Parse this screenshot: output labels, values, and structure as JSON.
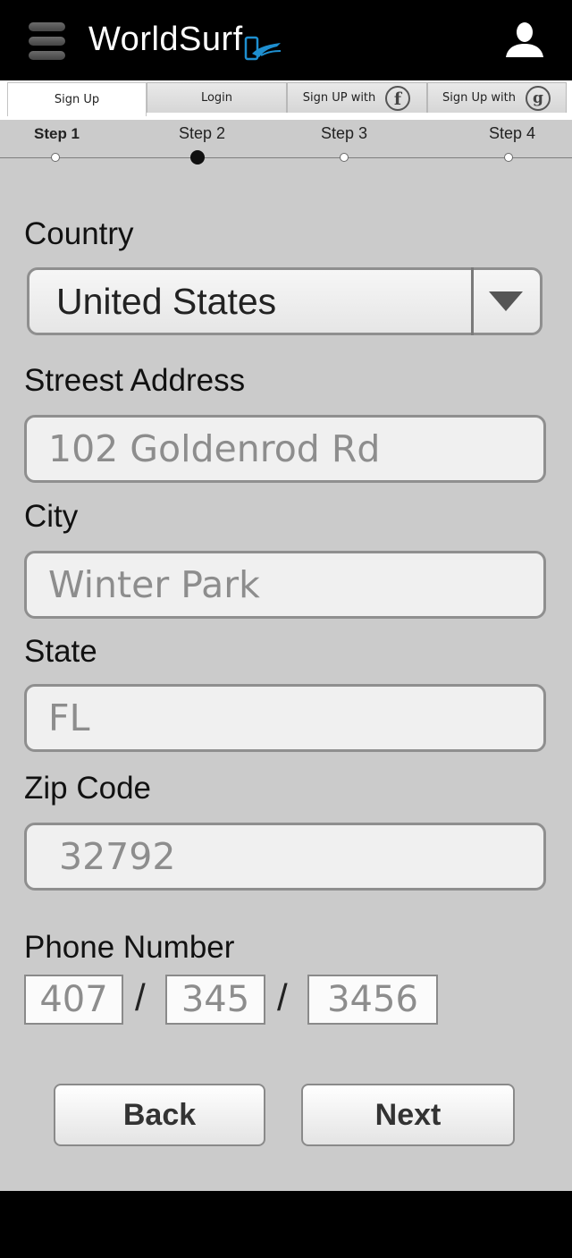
{
  "header": {
    "app_name": "WorldSurf"
  },
  "tabs": [
    {
      "label": "Sign Up",
      "active": true
    },
    {
      "label": "Login"
    },
    {
      "label": "Sign UP with",
      "icon": "facebook-icon"
    },
    {
      "label": "Sign Up with",
      "icon": "google-icon"
    }
  ],
  "steps": [
    {
      "label": "Step 1"
    },
    {
      "label": "Step 2",
      "current": true
    },
    {
      "label": "Step 3"
    },
    {
      "label": "Step 4"
    }
  ],
  "form": {
    "country": {
      "label": "Country",
      "value": "United States"
    },
    "street": {
      "label": "Streest Address",
      "placeholder": "102 Goldenrod Rd"
    },
    "city": {
      "label": "City",
      "placeholder": "Winter Park"
    },
    "state": {
      "label": "State",
      "placeholder": "FL"
    },
    "zip": {
      "label": "Zip Code",
      "placeholder": "32792"
    },
    "phone": {
      "label": "Phone Number",
      "area_placeholder": "407",
      "prefix_placeholder": "345",
      "line_placeholder": "3456",
      "separator": "/"
    }
  },
  "actions": {
    "back_label": "Back",
    "next_label": "Next"
  },
  "colors": {
    "background": "#cbcbcb",
    "header": "#000000",
    "input_bg": "#f0f0f0",
    "logo_accent": "#1e8fd0"
  }
}
